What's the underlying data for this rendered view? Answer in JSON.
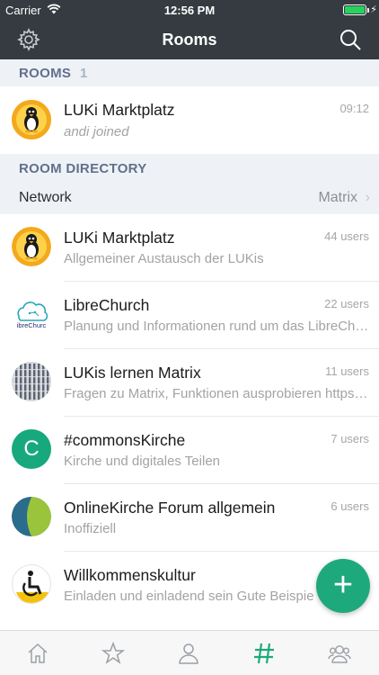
{
  "status_bar": {
    "carrier": "Carrier",
    "time": "12:56 PM"
  },
  "nav": {
    "title": "Rooms",
    "left_icon": "gear-icon",
    "right_icon": "search-icon"
  },
  "rooms_section": {
    "label": "ROOMS",
    "count": "1"
  },
  "rooms": [
    {
      "name": "LUKi Marktplatz",
      "subtitle": "andi joined",
      "time": "09:12",
      "avatar": "tux-logo"
    }
  ],
  "directory_section": {
    "label": "ROOM DIRECTORY"
  },
  "network": {
    "label": "Network",
    "value": "Matrix",
    "chevron": "›"
  },
  "directory": [
    {
      "name": "LUKi Marktplatz",
      "subtitle": "Allgemeiner Austausch der LUKis",
      "users": "44 users",
      "avatar": "tux-logo"
    },
    {
      "name": "LibreChurch",
      "subtitle": "Planung und Informationen rund um das LibreCh…",
      "users": "22 users",
      "avatar": "librechurch-logo",
      "avatar_text": "ibreChurc"
    },
    {
      "name": "LUKis lernen Matrix",
      "subtitle": "Fragen zu Matrix, Funktionen ausprobieren https…",
      "users": "11 users",
      "avatar": "building-photo"
    },
    {
      "name": "#commonsKirche",
      "subtitle": "Kirche und digitales Teilen",
      "users": "7 users",
      "avatar": "letter-avatar",
      "avatar_letter": "C"
    },
    {
      "name": "OnlineKirche Forum allgemein",
      "subtitle": "Inoffiziell",
      "users": "6 users",
      "avatar": "green-blue-circle"
    },
    {
      "name": "Willkommenskultur",
      "subtitle": "Einladen und einladend sein Gute Beispie…",
      "users": "",
      "avatar": "wheelchair-icon"
    }
  ],
  "fab": {
    "label": "+"
  },
  "tabs": [
    {
      "name": "home-tab",
      "icon": "home-icon"
    },
    {
      "name": "favourites-tab",
      "icon": "star-icon"
    },
    {
      "name": "people-tab",
      "icon": "person-icon"
    },
    {
      "name": "rooms-tab",
      "icon": "hash-icon",
      "active": true
    },
    {
      "name": "groups-tab",
      "icon": "group-icon"
    }
  ],
  "colors": {
    "nav_bg": "#353b40",
    "section_bg": "#eef2f7",
    "accent": "#1ea97c",
    "letter_avatar": "#17a87e"
  }
}
